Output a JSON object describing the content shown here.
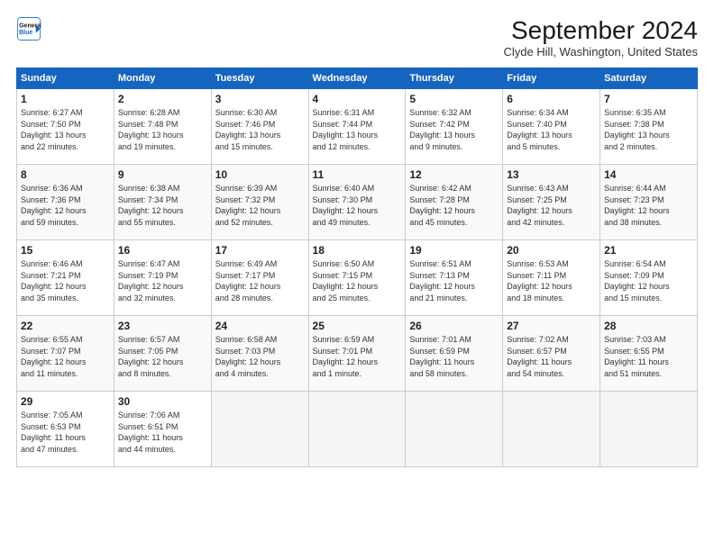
{
  "header": {
    "logo_line1": "General",
    "logo_line2": "Blue",
    "main_title": "September 2024",
    "subtitle": "Clyde Hill, Washington, United States"
  },
  "weekdays": [
    "Sunday",
    "Monday",
    "Tuesday",
    "Wednesday",
    "Thursday",
    "Friday",
    "Saturday"
  ],
  "weeks": [
    [
      {
        "day": "1",
        "info": "Sunrise: 6:27 AM\nSunset: 7:50 PM\nDaylight: 13 hours\nand 22 minutes."
      },
      {
        "day": "2",
        "info": "Sunrise: 6:28 AM\nSunset: 7:48 PM\nDaylight: 13 hours\nand 19 minutes."
      },
      {
        "day": "3",
        "info": "Sunrise: 6:30 AM\nSunset: 7:46 PM\nDaylight: 13 hours\nand 15 minutes."
      },
      {
        "day": "4",
        "info": "Sunrise: 6:31 AM\nSunset: 7:44 PM\nDaylight: 13 hours\nand 12 minutes."
      },
      {
        "day": "5",
        "info": "Sunrise: 6:32 AM\nSunset: 7:42 PM\nDaylight: 13 hours\nand 9 minutes."
      },
      {
        "day": "6",
        "info": "Sunrise: 6:34 AM\nSunset: 7:40 PM\nDaylight: 13 hours\nand 5 minutes."
      },
      {
        "day": "7",
        "info": "Sunrise: 6:35 AM\nSunset: 7:38 PM\nDaylight: 13 hours\nand 2 minutes."
      }
    ],
    [
      {
        "day": "8",
        "info": "Sunrise: 6:36 AM\nSunset: 7:36 PM\nDaylight: 12 hours\nand 59 minutes."
      },
      {
        "day": "9",
        "info": "Sunrise: 6:38 AM\nSunset: 7:34 PM\nDaylight: 12 hours\nand 55 minutes."
      },
      {
        "day": "10",
        "info": "Sunrise: 6:39 AM\nSunset: 7:32 PM\nDaylight: 12 hours\nand 52 minutes."
      },
      {
        "day": "11",
        "info": "Sunrise: 6:40 AM\nSunset: 7:30 PM\nDaylight: 12 hours\nand 49 minutes."
      },
      {
        "day": "12",
        "info": "Sunrise: 6:42 AM\nSunset: 7:28 PM\nDaylight: 12 hours\nand 45 minutes."
      },
      {
        "day": "13",
        "info": "Sunrise: 6:43 AM\nSunset: 7:25 PM\nDaylight: 12 hours\nand 42 minutes."
      },
      {
        "day": "14",
        "info": "Sunrise: 6:44 AM\nSunset: 7:23 PM\nDaylight: 12 hours\nand 38 minutes."
      }
    ],
    [
      {
        "day": "15",
        "info": "Sunrise: 6:46 AM\nSunset: 7:21 PM\nDaylight: 12 hours\nand 35 minutes."
      },
      {
        "day": "16",
        "info": "Sunrise: 6:47 AM\nSunset: 7:19 PM\nDaylight: 12 hours\nand 32 minutes."
      },
      {
        "day": "17",
        "info": "Sunrise: 6:49 AM\nSunset: 7:17 PM\nDaylight: 12 hours\nand 28 minutes."
      },
      {
        "day": "18",
        "info": "Sunrise: 6:50 AM\nSunset: 7:15 PM\nDaylight: 12 hours\nand 25 minutes."
      },
      {
        "day": "19",
        "info": "Sunrise: 6:51 AM\nSunset: 7:13 PM\nDaylight: 12 hours\nand 21 minutes."
      },
      {
        "day": "20",
        "info": "Sunrise: 6:53 AM\nSunset: 7:11 PM\nDaylight: 12 hours\nand 18 minutes."
      },
      {
        "day": "21",
        "info": "Sunrise: 6:54 AM\nSunset: 7:09 PM\nDaylight: 12 hours\nand 15 minutes."
      }
    ],
    [
      {
        "day": "22",
        "info": "Sunrise: 6:55 AM\nSunset: 7:07 PM\nDaylight: 12 hours\nand 11 minutes."
      },
      {
        "day": "23",
        "info": "Sunrise: 6:57 AM\nSunset: 7:05 PM\nDaylight: 12 hours\nand 8 minutes."
      },
      {
        "day": "24",
        "info": "Sunrise: 6:58 AM\nSunset: 7:03 PM\nDaylight: 12 hours\nand 4 minutes."
      },
      {
        "day": "25",
        "info": "Sunrise: 6:59 AM\nSunset: 7:01 PM\nDaylight: 12 hours\nand 1 minute."
      },
      {
        "day": "26",
        "info": "Sunrise: 7:01 AM\nSunset: 6:59 PM\nDaylight: 11 hours\nand 58 minutes."
      },
      {
        "day": "27",
        "info": "Sunrise: 7:02 AM\nSunset: 6:57 PM\nDaylight: 11 hours\nand 54 minutes."
      },
      {
        "day": "28",
        "info": "Sunrise: 7:03 AM\nSunset: 6:55 PM\nDaylight: 11 hours\nand 51 minutes."
      }
    ],
    [
      {
        "day": "29",
        "info": "Sunrise: 7:05 AM\nSunset: 6:53 PM\nDaylight: 11 hours\nand 47 minutes."
      },
      {
        "day": "30",
        "info": "Sunrise: 7:06 AM\nSunset: 6:51 PM\nDaylight: 11 hours\nand 44 minutes."
      },
      {
        "day": "",
        "info": ""
      },
      {
        "day": "",
        "info": ""
      },
      {
        "day": "",
        "info": ""
      },
      {
        "day": "",
        "info": ""
      },
      {
        "day": "",
        "info": ""
      }
    ]
  ]
}
